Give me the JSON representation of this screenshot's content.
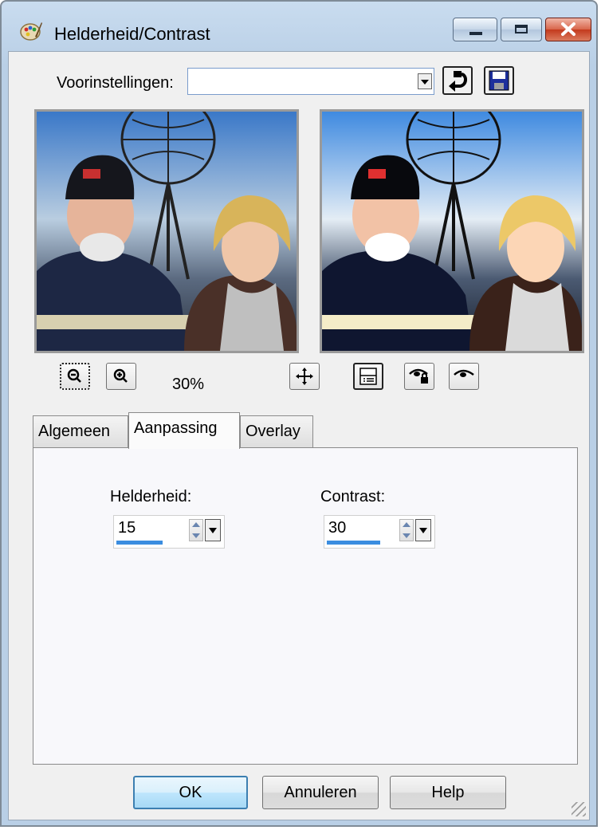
{
  "window": {
    "title": "Helderheid/Contrast"
  },
  "presets": {
    "label": "Voorinstellingen:",
    "value": ""
  },
  "preview": {
    "zoom": "30%"
  },
  "tabs": [
    {
      "label": "Algemeen",
      "active": false
    },
    {
      "label": "Aanpassing",
      "active": true
    },
    {
      "label": "Overlay",
      "active": false
    }
  ],
  "fields": {
    "brightness": {
      "label": "Helderheid:",
      "value": "15",
      "level": 0.15
    },
    "contrast": {
      "label": "Contrast:",
      "value": "30",
      "level": 0.3
    }
  },
  "buttons": {
    "ok": "OK",
    "cancel": "Annuleren",
    "help": "Help"
  },
  "colors": {
    "accent": "#3b8de0",
    "default_button_border": "#3c7fb1"
  }
}
